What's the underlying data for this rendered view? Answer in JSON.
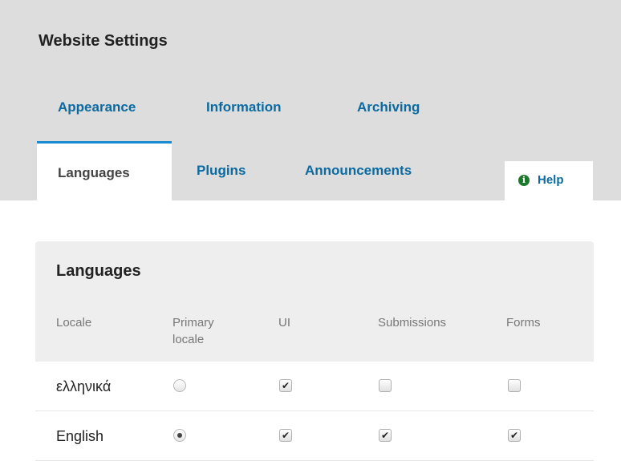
{
  "page": {
    "title": "Website Settings"
  },
  "tabs": {
    "primary": [
      "Appearance",
      "Information",
      "Archiving"
    ],
    "secondary": [
      "Languages",
      "Plugins",
      "Announcements"
    ],
    "active": "Languages"
  },
  "help": {
    "label": "Help",
    "icon_glyph": "i",
    "icon_name": "info-icon"
  },
  "languages": {
    "title": "Languages",
    "columns": {
      "locale": "Locale",
      "primary_line1": "Primary",
      "primary_line2": "locale",
      "ui": "UI",
      "submissions": "Submissions",
      "forms": "Forms"
    },
    "rows": [
      {
        "name": "ελληνικά",
        "primary": false,
        "ui": true,
        "submissions": false,
        "forms": false
      },
      {
        "name": "English",
        "primary": true,
        "ui": true,
        "submissions": true,
        "forms": true
      }
    ],
    "check_glyph": "✔"
  },
  "colors": {
    "link_blue": "#0a6aa1",
    "active_tab_border": "#1a8bd0",
    "info_icon_green": "#1d7a2c",
    "header_band": "#dddddd"
  }
}
